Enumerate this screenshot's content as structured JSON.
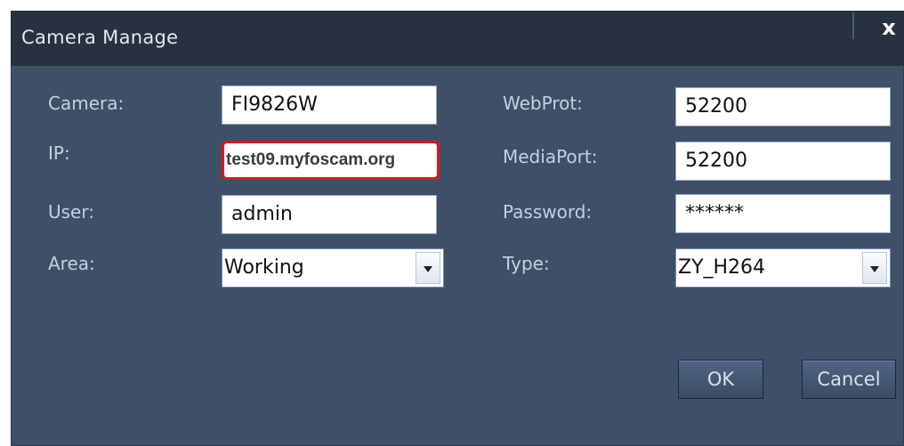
{
  "dialog": {
    "title": "Camera Manage",
    "close_label": "x"
  },
  "fields": {
    "camera": {
      "label": "Camera:",
      "value": "FI9826W"
    },
    "ip": {
      "label": "IP:",
      "value": "test09.myfoscam.org"
    },
    "user": {
      "label": "User:",
      "value": "admin"
    },
    "area": {
      "label": "Area:",
      "value": "Working"
    },
    "webport": {
      "label": "WebProt:",
      "value": "52200"
    },
    "mediaport": {
      "label": "MediaPort:",
      "value": "52200"
    },
    "password": {
      "label": "Password:",
      "value": "******"
    },
    "type": {
      "label": "Type:",
      "value": "ZY_H264"
    }
  },
  "buttons": {
    "ok": "OK",
    "cancel": "Cancel"
  },
  "colors": {
    "dialog_bg": "#3e5068",
    "titlebar_bg": "#27313f",
    "highlight_border": "#e0141e"
  },
  "icons": {
    "dropdown": "chevron-down-icon",
    "close": "close-icon"
  }
}
